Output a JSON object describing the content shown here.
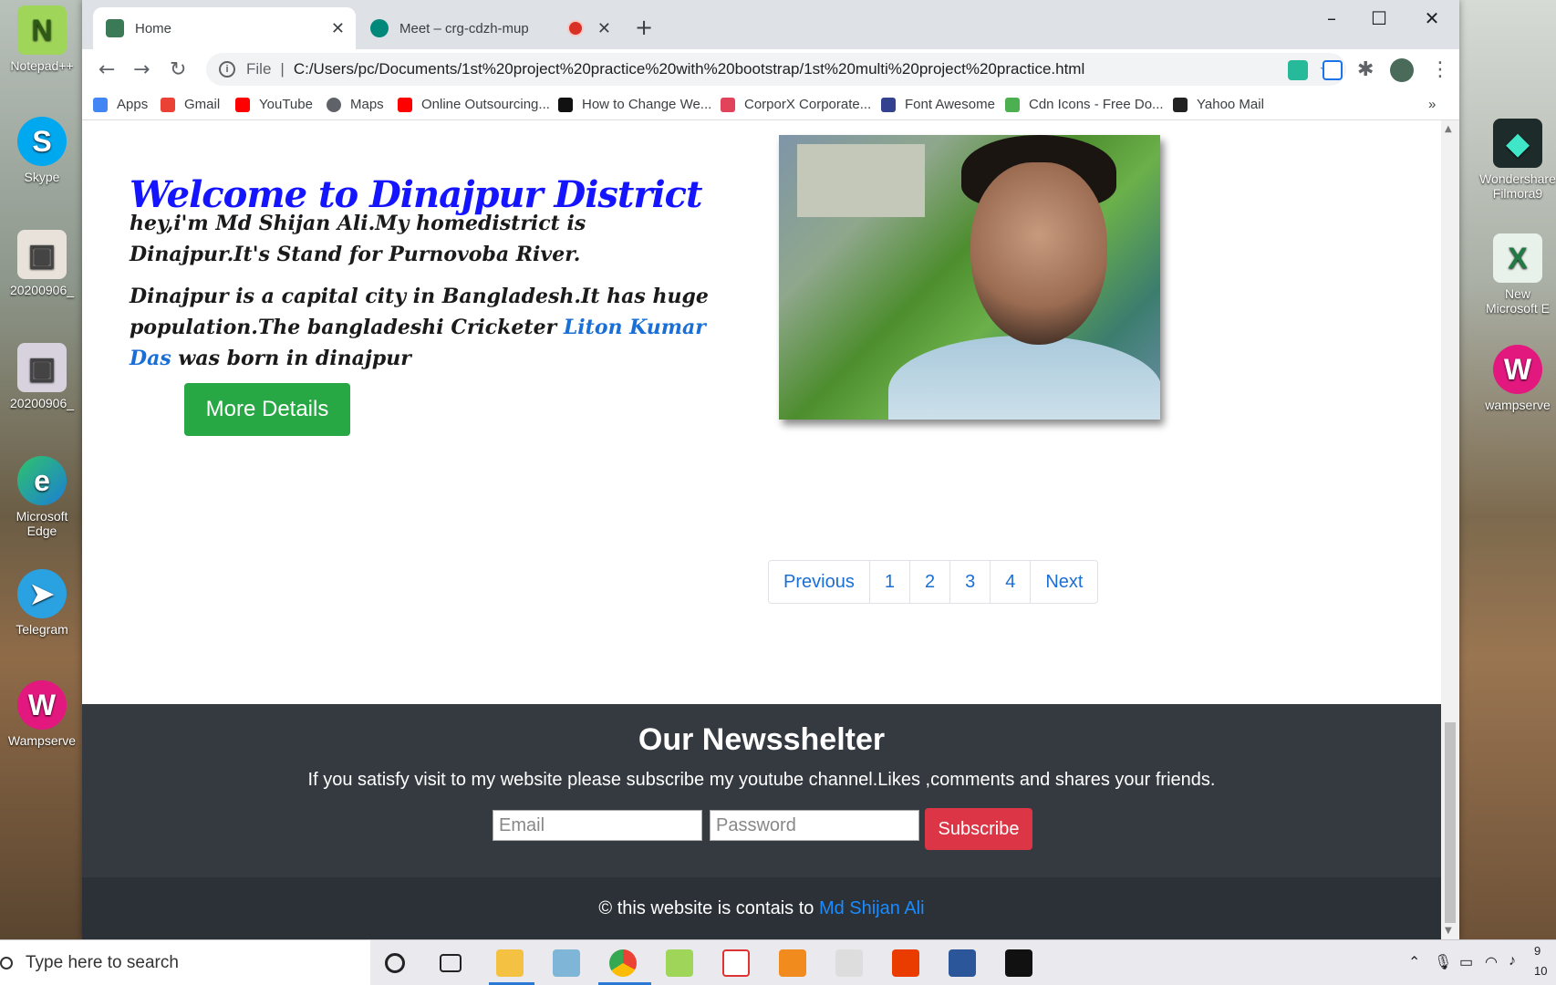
{
  "desktop": {
    "left_icons": [
      {
        "label": "Notepad++"
      },
      {
        "label": "Skype"
      },
      {
        "label": "20200906_"
      },
      {
        "label": "20200906_"
      },
      {
        "label": "Microsoft Edge"
      },
      {
        "label": "Telegram"
      },
      {
        "label": "Wampserve"
      }
    ],
    "right_icons": [
      {
        "label": "Wondershare Filmora9"
      },
      {
        "label": "New Microsoft E"
      },
      {
        "label": "wampserve"
      }
    ]
  },
  "browser": {
    "tabs": [
      {
        "title": "Home",
        "active": true
      },
      {
        "title": "Meet – crg-cdzh-mup",
        "active": false,
        "recording": true
      }
    ],
    "new_tab_label": "+",
    "window_controls": {
      "minimize": "–",
      "maximize": "☐",
      "close": "✕"
    },
    "omnibox": {
      "scheme": "File",
      "url": "C:/Users/pc/Documents/1st%20project%20practice%20with%20bootstrap/1st%20multi%20project%20practice.html"
    },
    "bookmarks": [
      {
        "label": "Apps",
        "color": "#4285f4"
      },
      {
        "label": "Gmail",
        "color": "#ea4335"
      },
      {
        "label": "YouTube",
        "color": "#ff0000"
      },
      {
        "label": "Maps",
        "color": "#5f6368"
      },
      {
        "label": "Online Outsourcing...",
        "color": "#ff0000"
      },
      {
        "label": "How to Change We...",
        "color": "#111111"
      },
      {
        "label": "CorporX Corporate...",
        "color": "#e0435a"
      },
      {
        "label": "Font Awesome",
        "color": "#33418f"
      },
      {
        "label": "Cdn Icons - Free Do...",
        "color": "#4caf50"
      },
      {
        "label": "Yahoo Mail",
        "color": "#222222"
      }
    ],
    "bookmarks_more": "»"
  },
  "page": {
    "hero": {
      "title": "Welcome to Dinajpur District",
      "para1": "hey,i'm Md Shijan Ali.My homedistrict is Dinajpur.It's Stand for Purnovoba River.",
      "para2_before": "Dinajpur is a capital city in Bangladesh.It has huge population.The bangladeshi Cricketer ",
      "para2_link": "Liton Kumar Das",
      "para2_after": " was born in dinajpur",
      "button": "More Details"
    },
    "pagination": [
      "Previous",
      "1",
      "2",
      "3",
      "4",
      "Next"
    ],
    "newsletter": {
      "title": "Our Newsshelter",
      "subtitle": "If you satisfy visit to my website please subscribe my youtube channel.Likes ,comments and shares your friends.",
      "email_placeholder": "Email",
      "password_placeholder": "Password",
      "button": "Subscribe"
    },
    "footer": {
      "text": "© this website is contais to ",
      "link": "Md Shijan Ali"
    }
  },
  "taskbar": {
    "search_placeholder": "Type here to search",
    "time_partial": "9",
    "date_partial": "10"
  },
  "colors": {
    "hero_title": "#1414ff",
    "link": "#1a6fd6",
    "success": "#28a745",
    "danger": "#dc3545",
    "dark": "#343a40"
  }
}
